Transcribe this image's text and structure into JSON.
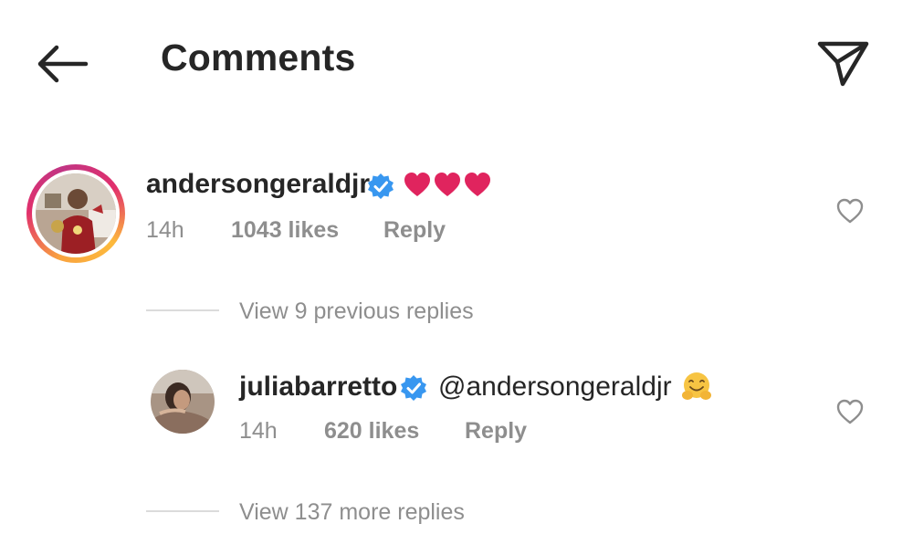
{
  "header": {
    "title": "Comments",
    "back_icon": "arrow-left-icon",
    "send_icon": "paper-plane-icon"
  },
  "comments": [
    {
      "username": "andersongeraldjr",
      "verified": true,
      "text": "❤❤❤",
      "time": "14h",
      "likes": "1043 likes",
      "reply_label": "Reply",
      "has_story_ring": true
    },
    {
      "username": "juliabarretto",
      "verified": true,
      "text": "@andersongeraldjr",
      "emoji": "🤗",
      "time": "14h",
      "likes": "620 likes",
      "reply_label": "Reply",
      "has_story_ring": false
    }
  ],
  "threads": {
    "previous_replies": "View 9 previous replies",
    "more_replies": "View 137 more replies"
  },
  "colors": {
    "text_primary": "#262626",
    "text_secondary": "#8e8e8e",
    "verified_blue": "#3897f0",
    "heart_red": "#e0245e",
    "divider": "#dbdbdb"
  }
}
